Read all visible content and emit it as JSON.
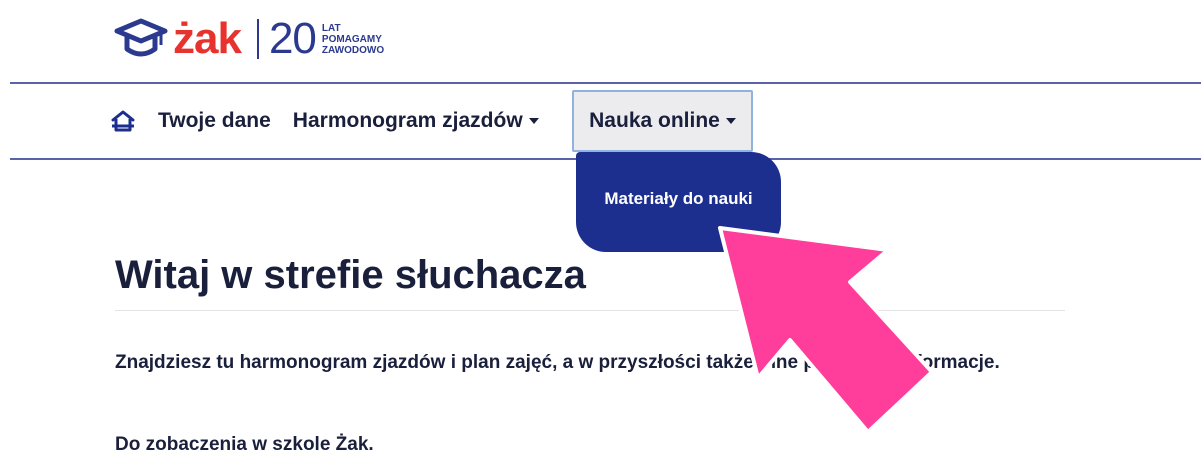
{
  "logo": {
    "brand": "żak",
    "number": "20",
    "tagline": [
      "LAT",
      "POMAGAMY",
      "ZAWODOWO"
    ],
    "brand_color": "#e8322e",
    "accent_color": "#2b3a8f"
  },
  "nav": {
    "home_icon": "home-icon",
    "items": [
      {
        "label": "Twoje dane"
      },
      {
        "label": "Harmonogram zjazdów"
      },
      {
        "label": "Nauka online"
      }
    ]
  },
  "dropdown": {
    "items": [
      {
        "label": "Materiały do nauki"
      }
    ],
    "bg_color": "#1c2f8f"
  },
  "main": {
    "heading": "Witaj w strefie słuchacza",
    "paragraph1": "Znajdziesz tu harmonogram zjazdów i plan zajęć, a w przyszłości także inne przydatne informacje.",
    "paragraph2": "Do zobaczenia w szkole Żak."
  },
  "annotation": {
    "arrow_icon": "pointer-arrow-icon",
    "arrow_color": "#ff3d9a"
  }
}
